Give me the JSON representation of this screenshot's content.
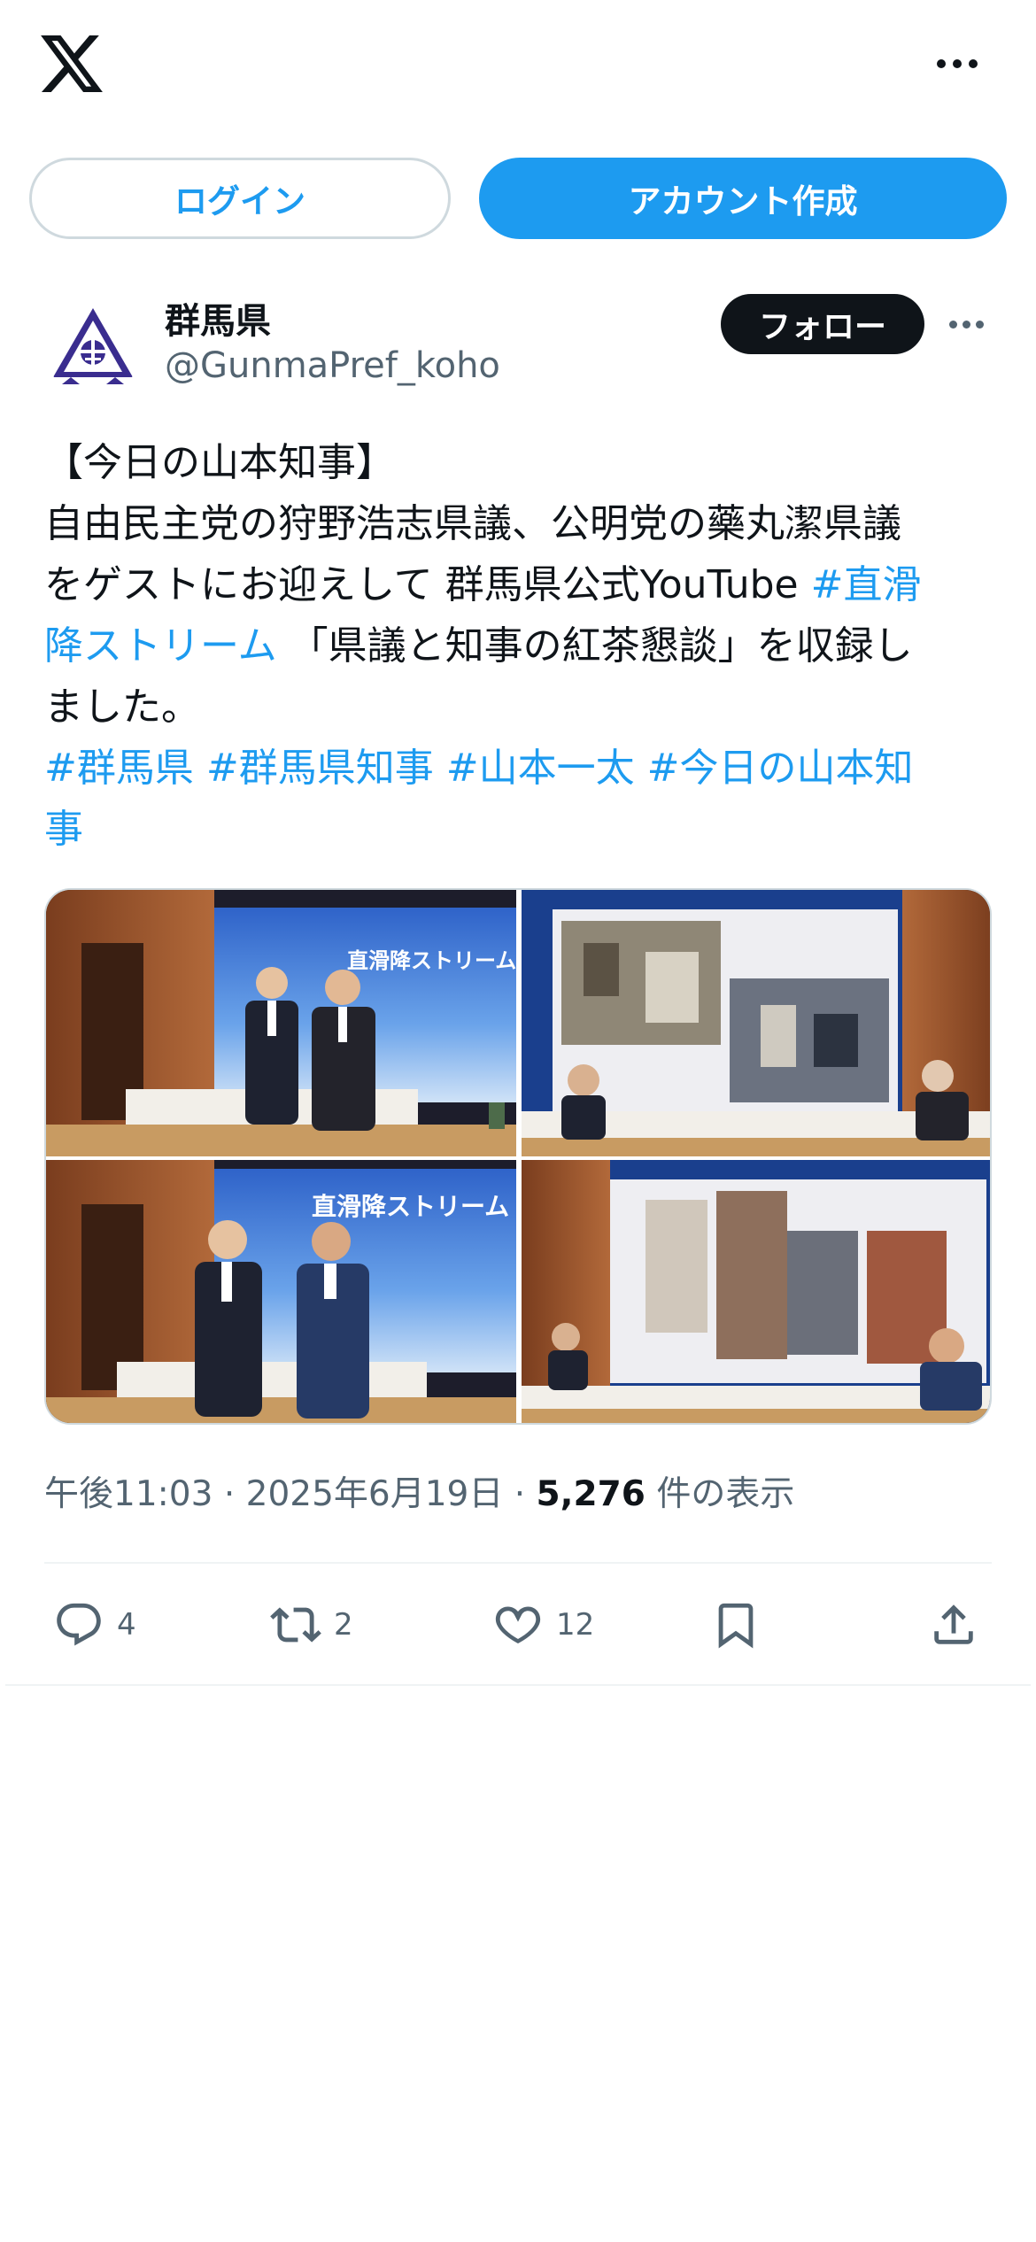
{
  "topbar": {
    "logo_icon": "x-logo-icon",
    "more_icon": "more-icon"
  },
  "auth": {
    "login_label": "ログイン",
    "signup_label": "アカウント作成"
  },
  "author": {
    "display_name": "群馬県",
    "handle": "@GunmaPref_koho",
    "follow_label": "フォロー",
    "avatar_icon": "gunma-emblem-icon",
    "more_icon": "more-icon"
  },
  "tweet": {
    "line1": "【今日の山本知事】",
    "line2": "自由民主党の狩野浩志県議、公明党の藥丸潔県議",
    "line3_text": "をゲストにお迎えして 群馬県公式YouTube ",
    "line3_link": "#直滑",
    "line4_link": "降ストリーム",
    "line4_text": " 「県議と知事の紅茶懇談」を収録し",
    "line5": "ました。",
    "hashtags_line1": [
      "#群馬県",
      "#群馬県知事",
      "#山本一太",
      "#今日の山本知"
    ],
    "hashtags_line2": "事"
  },
  "media": {
    "photos": [
      {
        "banner": "直滑降ストリーム"
      },
      {
        "banner": ""
      },
      {
        "banner": "直滑降ストリーム"
      },
      {
        "banner": ""
      }
    ]
  },
  "meta": {
    "time": "午後11:03",
    "date": "2025年6月19日",
    "views_count": "5,276",
    "views_label": "件の表示",
    "separator": "·"
  },
  "actions": {
    "reply_count": "4",
    "retweet_count": "2",
    "like_count": "12"
  },
  "colors": {
    "accent": "#1d9bf0",
    "text": "#0f1419",
    "secondary": "#536471",
    "border": "#cfd9de"
  }
}
